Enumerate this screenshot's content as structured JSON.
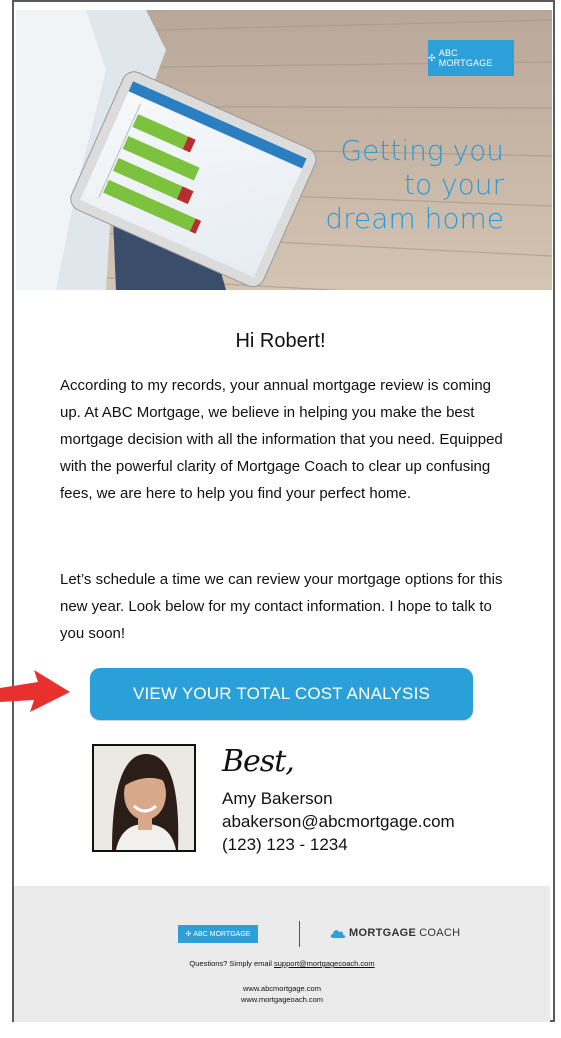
{
  "hero": {
    "brand_badge": "ABC MORTGAGE",
    "tagline_line1": "Getting you",
    "tagline_line2": "to your",
    "tagline_line3": "dream home"
  },
  "email": {
    "greeting": "Hi Robert!",
    "paragraph1": "According to my records, your annual mortgage review is coming up. At ABC Mortgage, we believe in helping you make the best mortgage decision with all the information that you need. Equipped with the powerful clarity of Mortgage Coach to clear up confusing fees, we are here to help you find your perfect home.",
    "paragraph2": "Let’s schedule a time we can review your mortgage options for this new year. Look below for my contact information. I hope to talk to you soon!",
    "cta_label": "VIEW YOUR TOTAL COST ANALYSIS"
  },
  "signature": {
    "closing": "Best,",
    "name": "Amy Bakerson",
    "email": "abakerson@abcmortgage.com",
    "phone": "(123) 123 - 1234"
  },
  "footer": {
    "brand_badge": "ABC MORTGAGE",
    "partner_bold": "MORTGAGE",
    "partner_light": "COACH",
    "questions_prefix": "Questions? Simply email ",
    "support_email": "support@mortgagecoach.com",
    "website1": "www.abcmortgage.com",
    "website2": "www.mortgageoach.com"
  },
  "colors": {
    "accent": "#2aa0d8",
    "arrow": "#e8302f",
    "footer_bg": "#ebebeb"
  }
}
